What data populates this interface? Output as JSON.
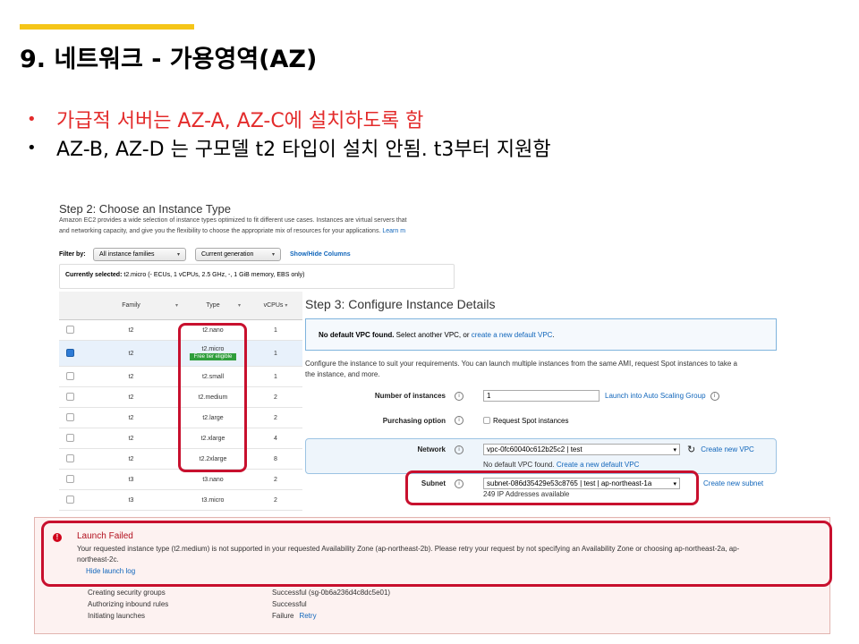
{
  "slide": {
    "title": "9. 네트워크 - 가용영역(AZ)",
    "bullets": [
      "가급적 서버는 AZ-A, AZ-C에 설치하도록 함",
      "AZ-B, AZ-D 는 구모델 t2 타입이 설치 안됨. t3부터 지원함"
    ],
    "accent_color": "#f5c518",
    "highlight_color": "#e32b2b"
  },
  "step2": {
    "title": "Step 2: Choose an Instance Type",
    "description": "Amazon EC2 provides a wide selection of instance types optimized to fit different use cases. Instances are virtual servers that",
    "description2": "and networking capacity, and give you the flexibility to choose the appropriate mix of resources for your applications.",
    "learn_more": "Learn m",
    "filter_label": "Filter by:",
    "filter_families": "All instance families",
    "filter_generation": "Current generation",
    "show_hide": "Show/Hide Columns",
    "currently_selected_label": "Currently selected:",
    "currently_selected_value": "t2.micro (- ECUs, 1 vCPUs, 2.5 GHz, -, 1 GiB memory, EBS only)",
    "columns": [
      "Family",
      "Type",
      "vCPUs"
    ],
    "rows": [
      {
        "family": "t2",
        "type": "t2.nano",
        "vcpus": "1",
        "badge": ""
      },
      {
        "family": "t2",
        "type": "t2.micro",
        "vcpus": "1",
        "badge": "Free tier eligible"
      },
      {
        "family": "t2",
        "type": "t2.small",
        "vcpus": "1",
        "badge": ""
      },
      {
        "family": "t2",
        "type": "t2.medium",
        "vcpus": "2",
        "badge": ""
      },
      {
        "family": "t2",
        "type": "t2.large",
        "vcpus": "2",
        "badge": ""
      },
      {
        "family": "t2",
        "type": "t2.xlarge",
        "vcpus": "4",
        "badge": ""
      },
      {
        "family": "t2",
        "type": "t2.2xlarge",
        "vcpus": "8",
        "badge": ""
      },
      {
        "family": "t3",
        "type": "t3.nano",
        "vcpus": "2",
        "badge": ""
      },
      {
        "family": "t3",
        "type": "t3.micro",
        "vcpus": "2",
        "badge": ""
      }
    ]
  },
  "step3": {
    "title": "Step 3: Configure Instance Details",
    "no_vpc_bold": "No default VPC found.",
    "no_vpc_text": "Select another VPC, or",
    "no_vpc_link": "create a new default VPC",
    "configure_desc": "Configure the instance to suit your requirements. You can launch multiple instances from the same AMI, request Spot instances to take a",
    "configure_desc2": "the instance, and more.",
    "number_label": "Number of instances",
    "number_value": "1",
    "auto_scaling_link": "Launch into Auto Scaling Group",
    "purchasing_label": "Purchasing option",
    "spot_label": "Request Spot instances",
    "network_label": "Network",
    "network_value": "vpc-0fc60040c612b25c2 | test",
    "create_vpc_link": "Create new VPC",
    "network_note": "No default VPC found.",
    "network_note_link": "Create a new default VPC",
    "subnet_label": "Subnet",
    "subnet_value": "subnet-086d35429e53c8765 | test | ap-northeast-1a",
    "subnet_available": "249 IP Addresses available",
    "create_subnet_link": "Create new subnet"
  },
  "launch": {
    "title": "Launch Failed",
    "message": "Your requested instance type (t2.medium) is not supported in your requested Availability Zone (ap-northeast-2b). Please retry your request by not specifying an Availability Zone or choosing ap-northeast-2a, ap-",
    "message2": "northeast-2c.",
    "hide_log": "Hide launch log",
    "log": [
      {
        "step": "Creating security groups",
        "status": "Successful (sg-0b6a236d4c8dc5e01)",
        "link": ""
      },
      {
        "step": "Authorizing inbound rules",
        "status": "Successful",
        "link": ""
      },
      {
        "step": "Initiating launches",
        "status": "Failure",
        "link": "Retry"
      }
    ]
  }
}
